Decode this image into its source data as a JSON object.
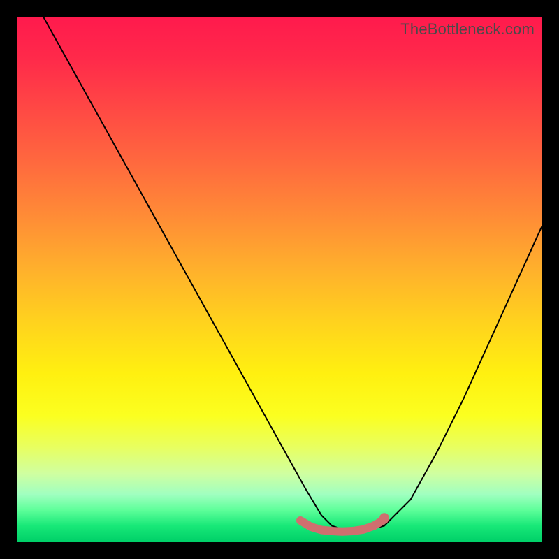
{
  "watermark": "TheBottleneck.com",
  "chart_data": {
    "type": "line",
    "title": "",
    "xlabel": "",
    "ylabel": "",
    "xlim": [
      0,
      100
    ],
    "ylim": [
      0,
      100
    ],
    "grid": false,
    "legend": false,
    "series": [
      {
        "name": "bottleneck-curve",
        "x": [
          5,
          10,
          15,
          20,
          25,
          30,
          35,
          40,
          45,
          50,
          55,
          58,
          60,
          63,
          66,
          70,
          75,
          80,
          85,
          90,
          95,
          100
        ],
        "values": [
          100,
          91,
          82,
          73,
          64,
          55,
          46,
          37,
          28,
          19,
          10,
          5,
          3,
          2,
          2,
          3,
          8,
          17,
          27,
          38,
          49,
          60
        ],
        "color": "#000000"
      },
      {
        "name": "optimal-band",
        "x": [
          54,
          56,
          58,
          60,
          62,
          64,
          66,
          68,
          70
        ],
        "values": [
          4.0,
          2.8,
          2.2,
          2.0,
          1.9,
          2.0,
          2.3,
          3.0,
          4.2
        ],
        "color": "#cf6f6f"
      }
    ],
    "markers": [
      {
        "name": "optimal-dot",
        "x": 70,
        "y": 4.5,
        "color": "#cf6f6f"
      }
    ]
  }
}
